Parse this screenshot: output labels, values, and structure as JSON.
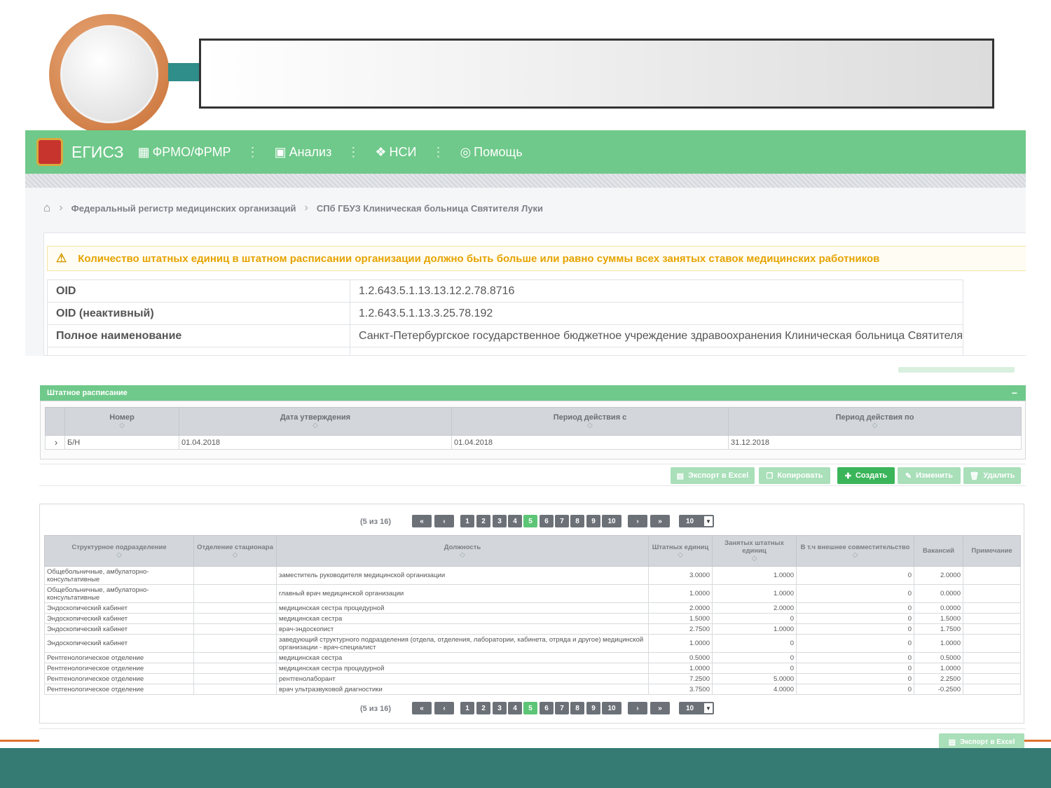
{
  "navbar": {
    "brand": "ЕГИСЗ",
    "items": [
      {
        "label": "ФРМО/ФРМР",
        "icon": "grid-icon"
      },
      {
        "label": "Анализ",
        "icon": "calendar-icon"
      },
      {
        "label": "НСИ",
        "icon": "cubes-icon"
      },
      {
        "label": "Помощь",
        "icon": "lifebuoy-icon"
      }
    ]
  },
  "breadcrumb": {
    "items": [
      "Федеральный регистр медицинских организаций",
      "СПб ГБУЗ Клиническая больница Святителя Луки"
    ]
  },
  "warning": {
    "text": "Количество штатных единиц в штатном расписании организации должно быть больше или равно суммы всех занятых ставок медицинских работников"
  },
  "info": {
    "rows": [
      {
        "key": "OID",
        "value": "1.2.643.5.1.13.13.12.2.78.8716"
      },
      {
        "key": "OID (неактивный)",
        "value": "1.2.643.5.1.13.3.25.78.192"
      },
      {
        "key": "Полное наименование",
        "value": "Санкт-Петербургское государственное бюджетное учреждение здравоохранения Клиническая больница Святителя"
      }
    ]
  },
  "schedule": {
    "title": "Штатное расписание",
    "collapse": "−",
    "headers": [
      "Номер",
      "Дата утверждения",
      "Период действия с",
      "Период действия по"
    ],
    "row": {
      "expand": "›",
      "number": "Б/Н",
      "approved": "01.04.2018",
      "from": "01.04.2018",
      "to": "31.12.2018"
    }
  },
  "actions": {
    "export": "Экспорт в Excel",
    "copy": "Копировать",
    "create": "Создать",
    "edit": "Изменить",
    "delete": "Удалить"
  },
  "pager": {
    "count": "(5 из 16)",
    "first": "«",
    "prev": "‹",
    "pages": [
      "1",
      "2",
      "3",
      "4",
      "5",
      "6",
      "7",
      "8",
      "9",
      "10"
    ],
    "active_page": "5",
    "next": "›",
    "last": "»",
    "page_size": "10"
  },
  "staff": {
    "headers": [
      "Структурное подразделение",
      "Отделение стационара",
      "Должность",
      "Штатных единиц",
      "Занятых штатных единиц",
      "В т.ч внешнее совместительство",
      "Вакансий",
      "Примечание"
    ],
    "rows": [
      {
        "dept": "Общебольничные, амбулаторно-консультативные",
        "ward": "",
        "position": "заместитель руководителя медицинской организации",
        "units": "3.0000",
        "occupied": "1.0000",
        "external": "0",
        "vacancies": "2.0000",
        "note": "",
        "tall": true
      },
      {
        "dept": "Общебольничные, амбулаторно-консультативные",
        "ward": "",
        "position": "главный врач медицинской организации",
        "units": "1.0000",
        "occupied": "1.0000",
        "external": "0",
        "vacancies": "0.0000",
        "note": "",
        "tall": true
      },
      {
        "dept": "Эндоскопический кабинет",
        "ward": "",
        "position": "медицинская сестра процедурной",
        "units": "2.0000",
        "occupied": "2.0000",
        "external": "0",
        "vacancies": "0.0000",
        "note": "",
        "tall": false
      },
      {
        "dept": "Эндоскопический кабинет",
        "ward": "",
        "position": "медицинская сестра",
        "units": "1.5000",
        "occupied": "0",
        "external": "0",
        "vacancies": "1.5000",
        "note": "",
        "tall": false
      },
      {
        "dept": "Эндоскопический кабинет",
        "ward": "",
        "position": "врач-эндоскопист",
        "units": "2.7500",
        "occupied": "1.0000",
        "external": "0",
        "vacancies": "1.7500",
        "note": "",
        "tall": false
      },
      {
        "dept": "Эндоскопический кабинет",
        "ward": "",
        "position": "заведующий структурного подразделения (отдела, отделения, лаборатории, кабинета, отряда и другое) медицинской организации - врач-специалист",
        "units": "1.0000",
        "occupied": "0",
        "external": "0",
        "vacancies": "1.0000",
        "note": "",
        "tall": true
      },
      {
        "dept": "Рентгенологическое отделение",
        "ward": "",
        "position": "медицинская сестра",
        "units": "0.5000",
        "occupied": "0",
        "external": "0",
        "vacancies": "0.5000",
        "note": "",
        "tall": false
      },
      {
        "dept": "Рентгенологическое отделение",
        "ward": "",
        "position": "медицинская сестра процедурной",
        "units": "1.0000",
        "occupied": "0",
        "external": "0",
        "vacancies": "1.0000",
        "note": "",
        "tall": false
      },
      {
        "dept": "Рентгенологическое отделение",
        "ward": "",
        "position": "рентгенолаборант",
        "units": "7.2500",
        "occupied": "5.0000",
        "external": "0",
        "vacancies": "2.2500",
        "note": "",
        "tall": false
      },
      {
        "dept": "Рентгенологическое отделение",
        "ward": "",
        "position": "врач ультразвуковой диагностики",
        "units": "3.7500",
        "occupied": "4.0000",
        "external": "0",
        "vacancies": "-0.2500",
        "note": "",
        "tall": false
      }
    ]
  },
  "colors": {
    "nav_green": "#6fc98a",
    "warning": "#e6a300",
    "teal_footer": "#357a73",
    "accent_orange": "#e0722e",
    "active_page": "#5cc576"
  }
}
